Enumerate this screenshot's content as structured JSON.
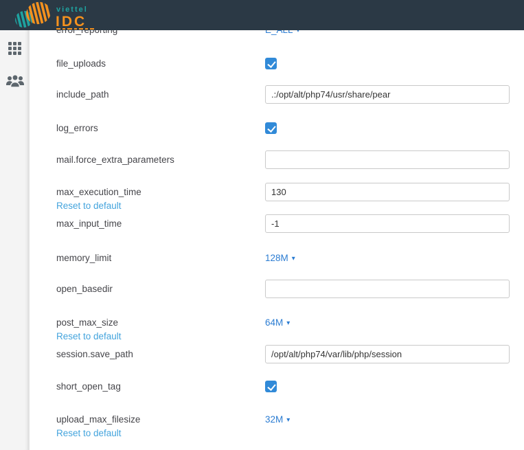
{
  "header": {
    "brand": {
      "word_top": "viettel",
      "word_bottom": "IDC"
    }
  },
  "sidebar": {
    "items": [
      {
        "icon": "grid-icon"
      },
      {
        "icon": "users-icon"
      }
    ]
  },
  "settings": {
    "reset_label": "Reset to default",
    "caret": "▾",
    "rows": [
      {
        "label": "error_reporting",
        "type": "dropdown",
        "value": "E_ALL"
      },
      {
        "label": "file_uploads",
        "type": "checkbox",
        "checked": true
      },
      {
        "label": "include_path",
        "type": "text",
        "value": ".:/opt/alt/php74/usr/share/pear"
      },
      {
        "label": "log_errors",
        "type": "checkbox",
        "checked": true
      },
      {
        "label": "mail.force_extra_parameters",
        "type": "text",
        "value": ""
      },
      {
        "label": "max_execution_time",
        "type": "text",
        "value": "130",
        "reset": true
      },
      {
        "label": "max_input_time",
        "type": "text",
        "value": "-1"
      },
      {
        "label": "memory_limit",
        "type": "dropdown",
        "value": "128M"
      },
      {
        "label": "open_basedir",
        "type": "text",
        "value": ""
      },
      {
        "label": "post_max_size",
        "type": "dropdown",
        "value": "64M",
        "reset": true
      },
      {
        "label": "session.save_path",
        "type": "text",
        "value": "/opt/alt/php74/var/lib/php/session"
      },
      {
        "label": "short_open_tag",
        "type": "checkbox",
        "checked": true
      },
      {
        "label": "upload_max_filesize",
        "type": "dropdown",
        "value": "32M",
        "reset": true
      }
    ]
  },
  "colors": {
    "header_bg": "#2b3945",
    "sidebar_bg": "#f4f4f4",
    "checkbox_blue": "#318ad8",
    "dropdown_link_blue": "#2b7cd2",
    "reset_link_blue": "#44a4dd",
    "brand_teal": "#1fa3a0",
    "brand_orange": "#f6921e",
    "label_text": "#45454a"
  }
}
